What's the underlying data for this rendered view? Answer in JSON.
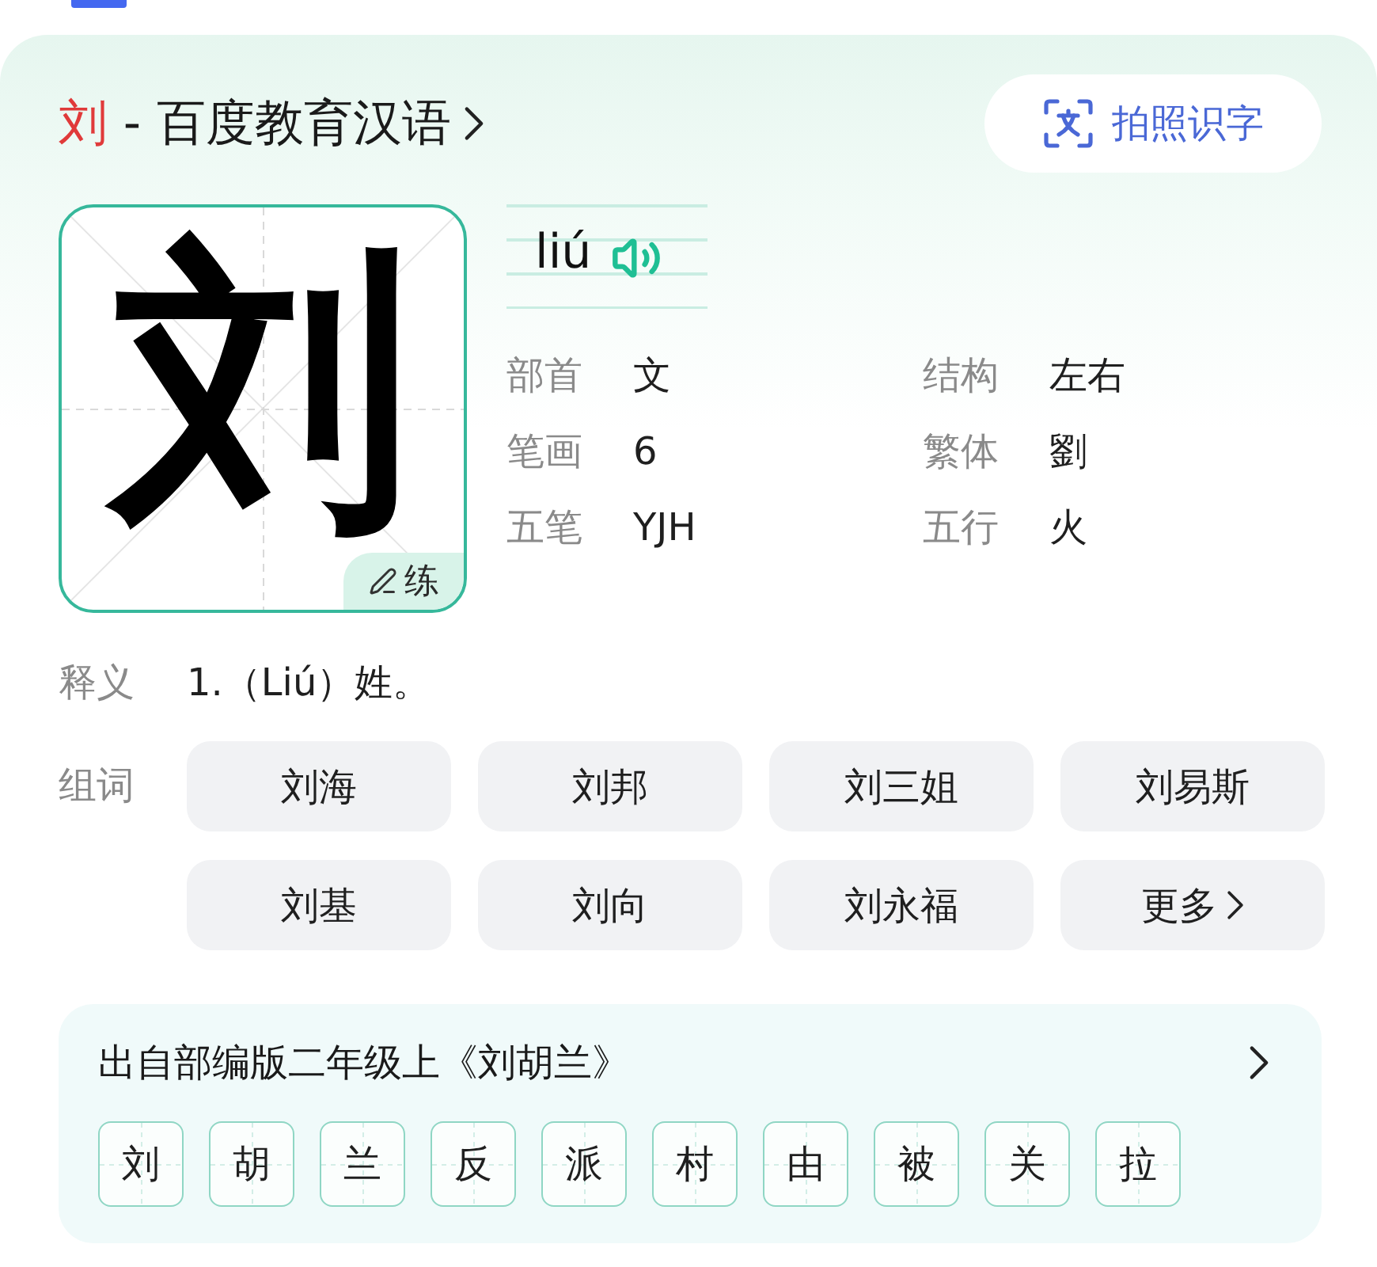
{
  "header": {
    "character": "刘",
    "title": "- 百度教育汉语"
  },
  "photo_button": {
    "label": "拍照识字"
  },
  "character_panel": {
    "character": "刘",
    "practice_label": "练"
  },
  "pinyin": {
    "text": "liú"
  },
  "info": [
    {
      "label": "部首",
      "value": "文"
    },
    {
      "label": "结构",
      "value": "左右"
    },
    {
      "label": "笔画",
      "value": "6"
    },
    {
      "label": "繁体",
      "value": "劉"
    },
    {
      "label": "五笔",
      "value": "YJH"
    },
    {
      "label": "五行",
      "value": "火"
    }
  ],
  "definition": {
    "label": "释义",
    "text": "1.（Liú）姓。"
  },
  "words": {
    "label": "组词",
    "items": [
      {
        "kind": "word",
        "text": "刘海"
      },
      {
        "kind": "word",
        "text": "刘邦"
      },
      {
        "kind": "word",
        "text": "刘三姐"
      },
      {
        "kind": "word",
        "text": "刘易斯"
      },
      {
        "kind": "word",
        "text": "刘基"
      },
      {
        "kind": "word",
        "text": "刘向"
      },
      {
        "kind": "word",
        "text": "刘永福"
      },
      {
        "kind": "more",
        "text": "更多"
      }
    ]
  },
  "source": {
    "title": "出自部编版二年级上《刘胡兰》",
    "characters": [
      "刘",
      "胡",
      "兰",
      "反",
      "派",
      "村",
      "由",
      "被",
      "关",
      "拉"
    ]
  }
}
